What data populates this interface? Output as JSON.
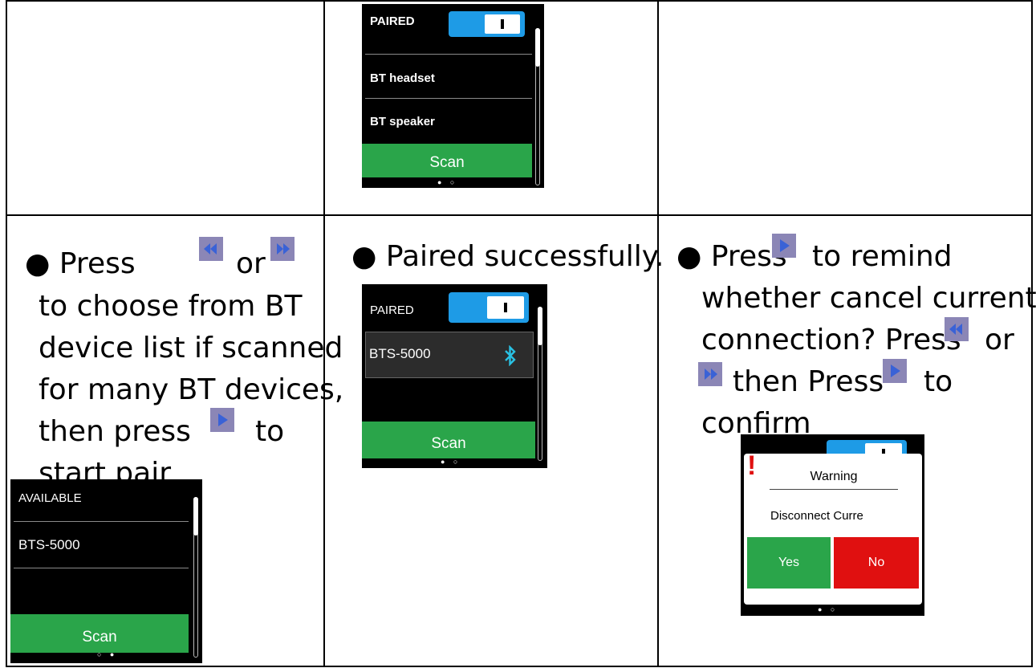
{
  "top_screen": {
    "paired_label": "PAIRED",
    "devices": [
      "BT headset",
      "BT speaker"
    ],
    "scan_label": "Scan",
    "page_dots": "● ○",
    "toggle_on": true
  },
  "left_cell": {
    "line1_a": "● Press",
    "line1_b": "or",
    "line2": "to choose from BT",
    "line3": "device list if scanned",
    "line4": "for many BT devices,",
    "line5_a": "then press",
    "line5_b": "to",
    "line6": "start pair",
    "icons": [
      "rewind-icon",
      "fast-forward-icon",
      "play-icon"
    ],
    "screen": {
      "header": "AVAILABLE",
      "devices": [
        "BTS-5000"
      ],
      "scan_label": "Scan",
      "page_dots": "○ ●"
    }
  },
  "middle_cell": {
    "text": "● Paired successfully.",
    "screen": {
      "paired_label": "PAIRED",
      "device": "BTS-5000",
      "scan_label": "Scan",
      "page_dots": "● ○",
      "icon": "bluetooth-icon"
    }
  },
  "right_cell": {
    "line1_a": "● Press",
    "line1_b": "to remind",
    "line2": "whether cancel current",
    "line3_a": "connection? Press",
    "line3_b": "or",
    "line4_a": "then Press",
    "line4_b": "to",
    "line5": "confirm",
    "icons": [
      "play-icon",
      "rewind-icon",
      "fast-forward-icon",
      "play-icon"
    ],
    "dialog": {
      "title": "Warning",
      "message": "Disconnect Curre",
      "yes_label": "Yes",
      "no_label": "No",
      "page_dots": "● ○",
      "icon": "warning-exclamation-icon"
    }
  },
  "colors": {
    "toggle_blue": "#1e9be6",
    "scan_green": "#2aa54a",
    "no_red": "#e01010",
    "media_icon_bg": "#8b86b6",
    "media_arrow": "#3a62d6"
  }
}
